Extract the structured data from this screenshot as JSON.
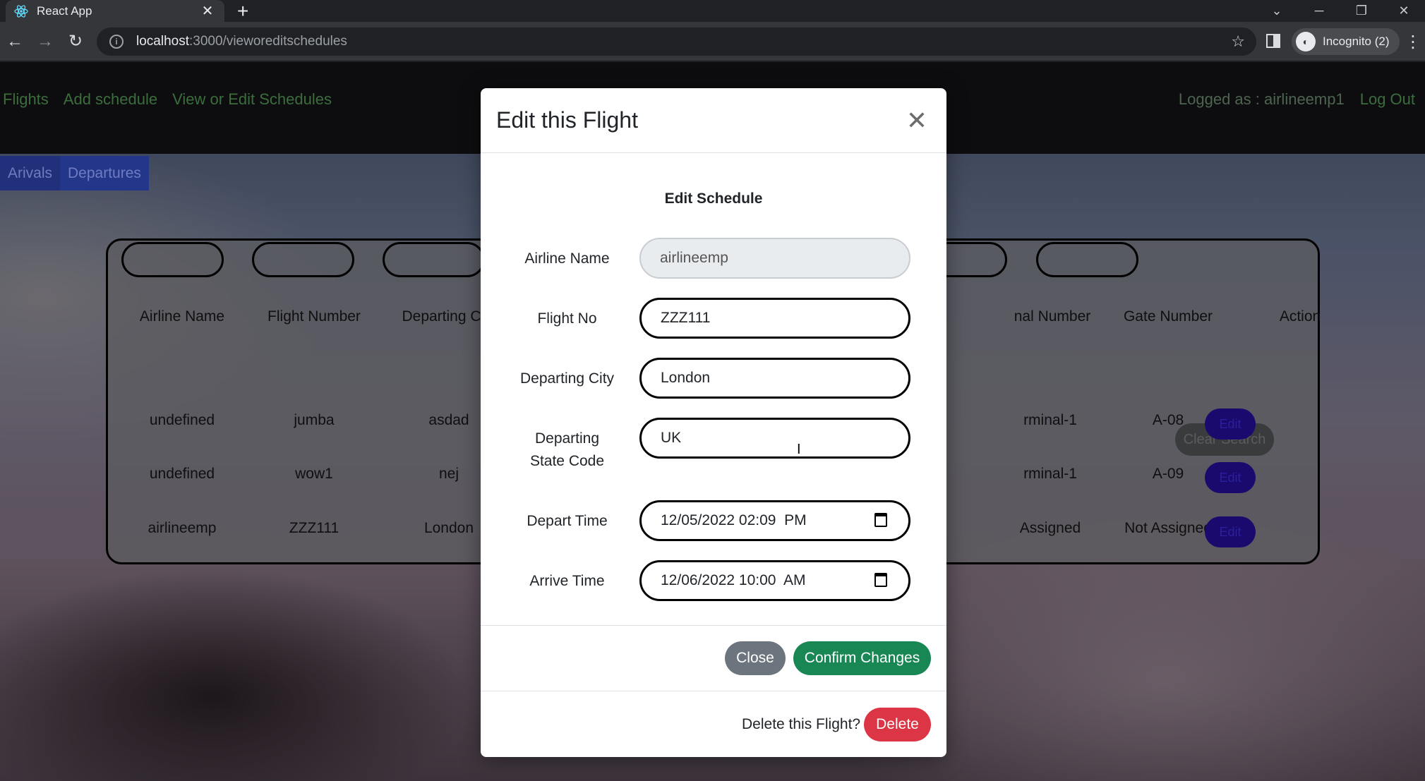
{
  "browser": {
    "tab_title": "React App",
    "url_host": "localhost",
    "url_path": ":3000/vieworeditschedules",
    "profile_label": "Incognito (2)",
    "icons": [
      "react-favicon",
      "close-icon",
      "plus-icon",
      "chevron-down-icon",
      "minimize-icon",
      "restore-icon",
      "close-window-icon",
      "back-arrow-icon",
      "forward-arrow-icon",
      "reload-icon",
      "info-icon",
      "star-icon",
      "side-panel-icon",
      "incognito-icon",
      "kebab-menu-icon"
    ]
  },
  "nav": {
    "links": [
      "Flights",
      "Add schedule",
      "View or Edit Schedules"
    ],
    "logged_as": "Logged as : airlineemp1",
    "logout": "Log Out"
  },
  "subtabs": [
    "Arivals",
    "Departures"
  ],
  "table": {
    "headers": [
      "Airline Name",
      "Flight Number",
      "Departing City",
      "nal Number",
      "Gate Number",
      "Action"
    ],
    "clear_search": "Clear Search",
    "edit_label": "Edit",
    "rows": [
      {
        "airline": "undefined",
        "flight": "jumba",
        "city": "asdad",
        "terminal": "rminal-1",
        "gate": "A-08"
      },
      {
        "airline": "undefined",
        "flight": "wow1",
        "city": "nej",
        "terminal": "rminal-1",
        "gate": "A-09"
      },
      {
        "airline": "airlineemp",
        "flight": "ZZZ111",
        "city": "London",
        "terminal": "Assigned",
        "gate": "Not Assigned"
      }
    ]
  },
  "modal": {
    "title": "Edit this Flight",
    "section_title": "Edit Schedule",
    "fields": {
      "airline_name": {
        "label": "Airline Name",
        "value": "airlineemp"
      },
      "flight_no": {
        "label": "Flight No",
        "value": "ZZZ111"
      },
      "departing_city": {
        "label": "Departing City",
        "value": "London"
      },
      "departing_state": {
        "label": "Departing State Code",
        "value": "UK"
      },
      "depart_time": {
        "label": "Depart Time",
        "value": "12/05/2022 02:09  PM"
      },
      "arrive_time": {
        "label": "Arrive Time",
        "value": "12/06/2022 10:00  AM"
      }
    },
    "close_label": "Close",
    "confirm_label": "Confirm Changes",
    "delete_prompt": "Delete this Flight?",
    "delete_label": "Delete"
  },
  "colors": {
    "nav_link": "#3b6d3d",
    "confirm": "#198754",
    "delete": "#dc3545",
    "secondary": "#6c757d",
    "edit_button": "#1a0a6e"
  }
}
